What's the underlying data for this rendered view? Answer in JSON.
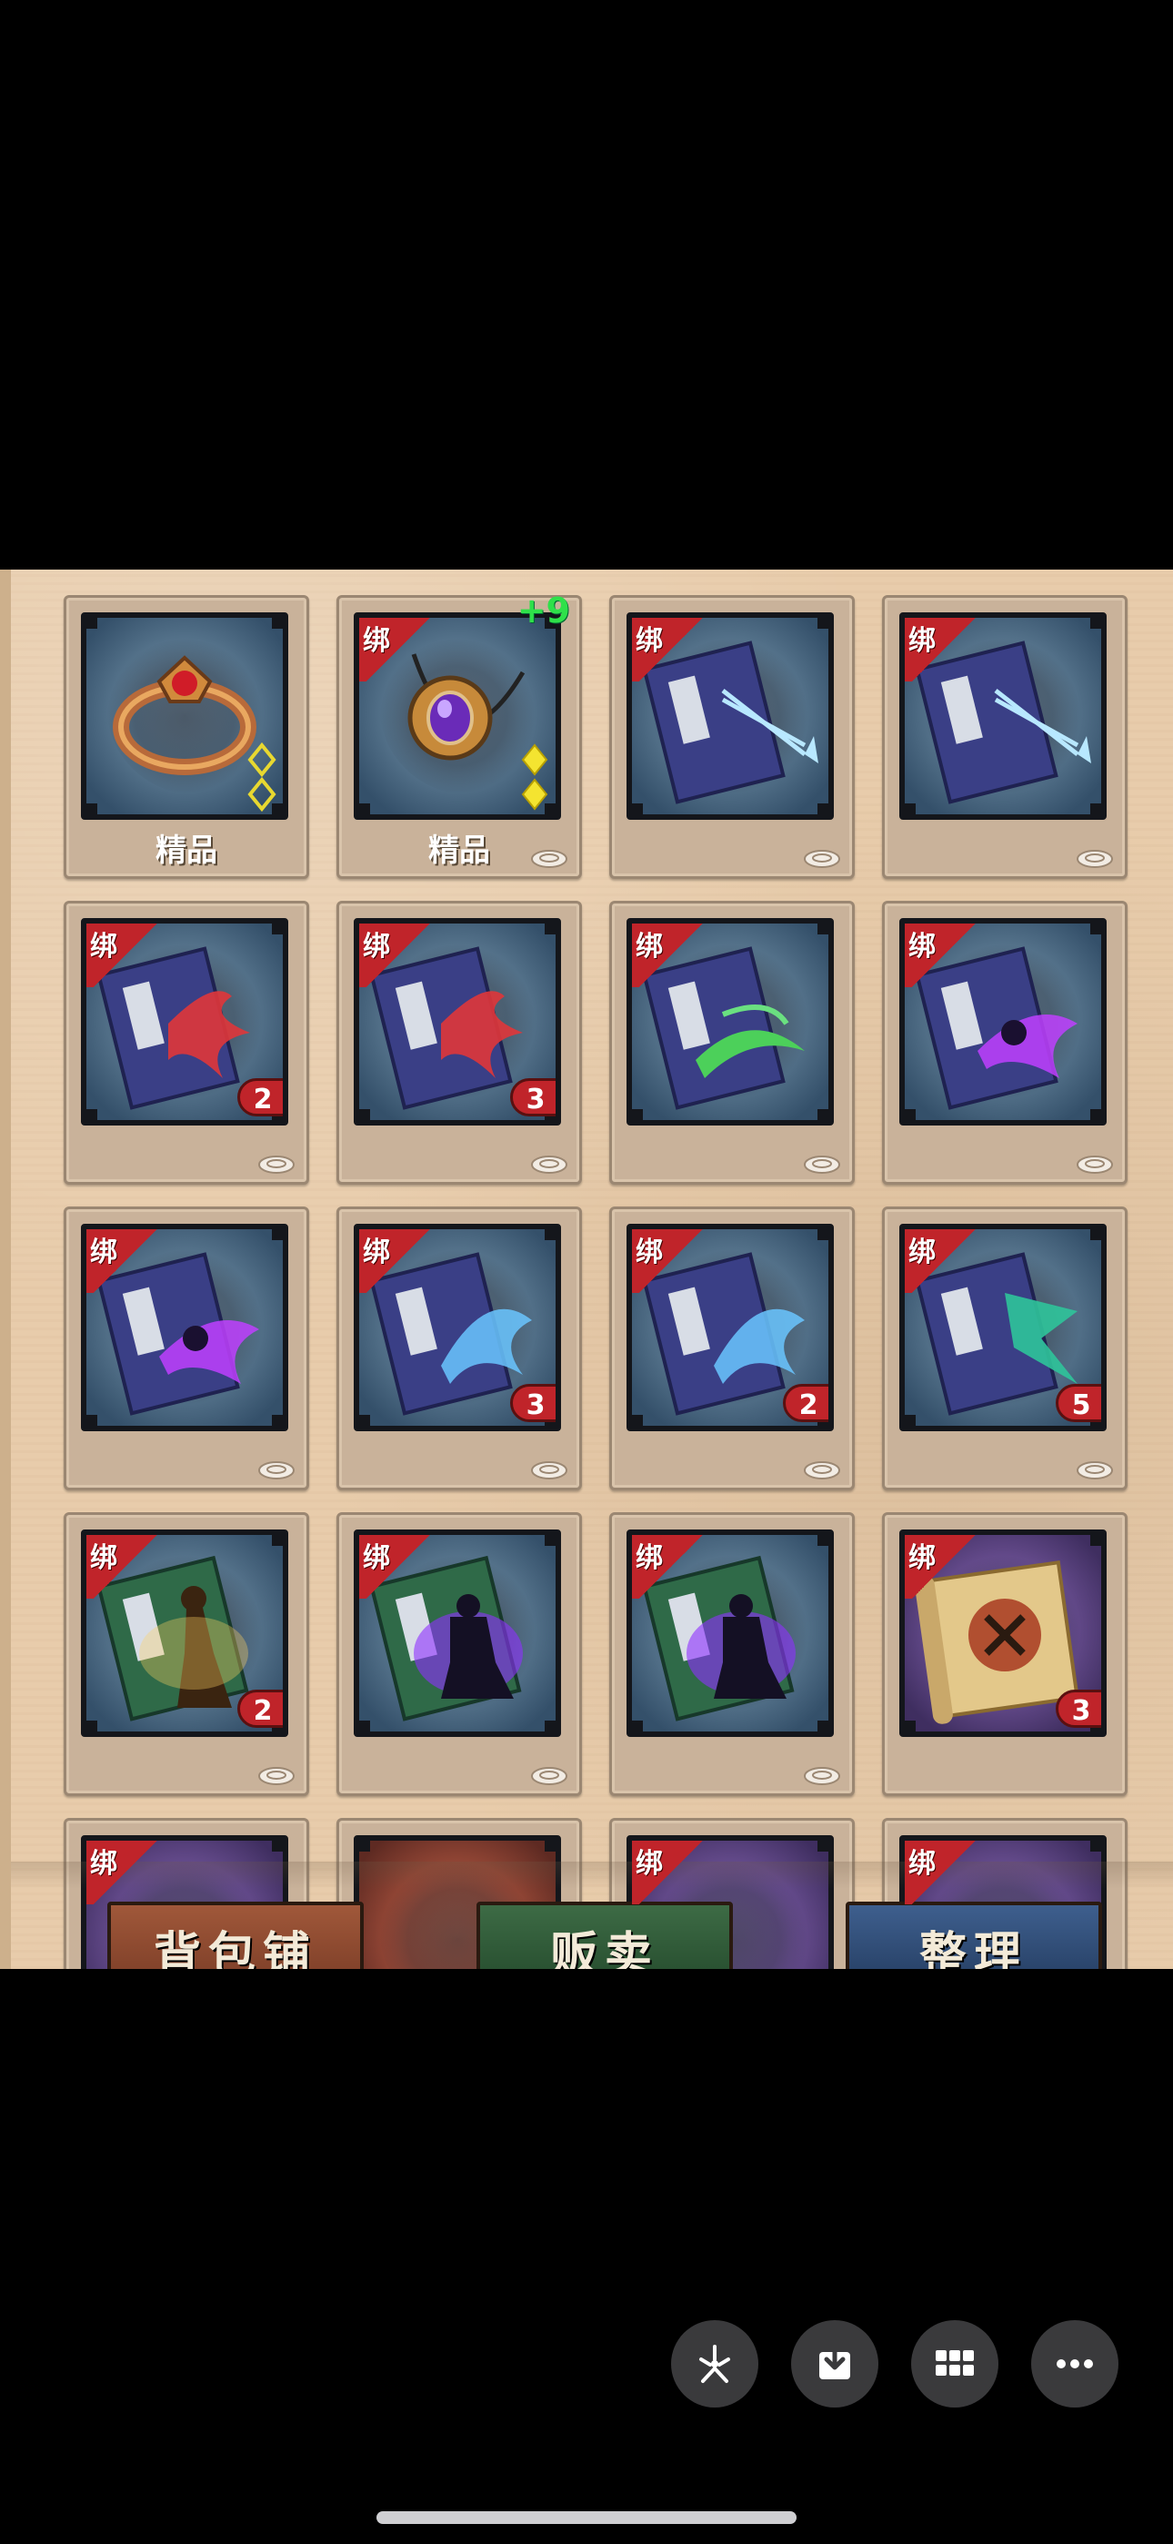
{
  "inventory": {
    "rows": [
      [
        {
          "art": "ring",
          "bound": false,
          "quality": "精品",
          "diamonds": "outline"
        },
        {
          "art": "amulet",
          "bound": "绑",
          "enhance": "+9",
          "quality": "精品",
          "diamonds": "filled",
          "coin": true
        },
        {
          "art": "book-darts",
          "bound": "绑",
          "coin": true
        },
        {
          "art": "book-darts",
          "bound": "绑",
          "coin": true
        }
      ],
      [
        {
          "art": "book-red",
          "bound": "绑",
          "count": "2",
          "coin": true
        },
        {
          "art": "book-red",
          "bound": "绑",
          "count": "3",
          "coin": true
        },
        {
          "art": "book-green",
          "bound": "绑",
          "coin": true
        },
        {
          "art": "book-purple",
          "bound": "绑",
          "coin": true
        }
      ],
      [
        {
          "art": "book-purple",
          "bound": "绑",
          "coin": true
        },
        {
          "art": "book-blue",
          "bound": "绑",
          "count": "3",
          "coin": true
        },
        {
          "art": "book-blue",
          "bound": "绑",
          "count": "2",
          "coin": true
        },
        {
          "art": "book-teal",
          "bound": "绑",
          "count": "5",
          "coin": true
        }
      ],
      [
        {
          "art": "book-gold-figure",
          "bound": "绑",
          "count": "2",
          "coin": true
        },
        {
          "art": "book-violet-figure",
          "bound": "绑",
          "coin": true
        },
        {
          "art": "book-violet-figure",
          "bound": "绑",
          "coin": true
        },
        {
          "art": "scroll",
          "bound": "绑",
          "count": "3",
          "tile": "purple"
        }
      ],
      [
        {
          "bound": "绑",
          "tile": "purple",
          "partial": true
        },
        {
          "bound": false,
          "tile": "rust",
          "partial": true
        },
        {
          "bound": "绑",
          "tile": "purple",
          "partial": true
        },
        {
          "bound": "绑",
          "tile": "purple",
          "partial": true
        }
      ]
    ]
  },
  "buttons": {
    "bag": "背包铺",
    "sell": "贩卖",
    "sort": "整理"
  },
  "overlay": {
    "icons": [
      "asterisk-icon",
      "download-icon",
      "grid-icon",
      "more-icon"
    ]
  }
}
